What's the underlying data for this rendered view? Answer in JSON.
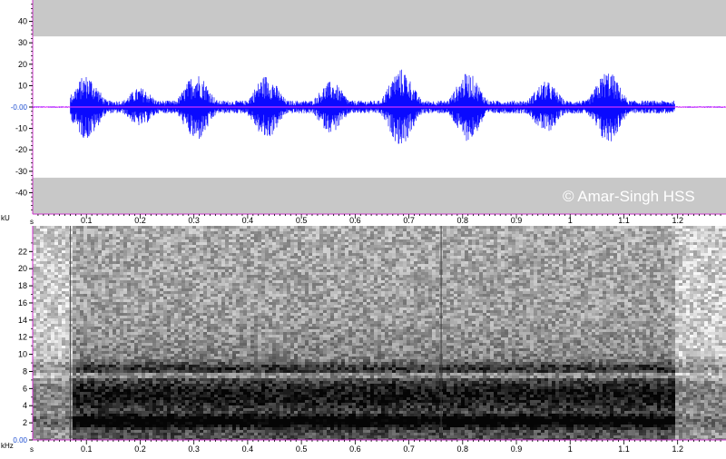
{
  "chart_data": [
    {
      "type": "line",
      "name": "waveform",
      "ylabel": "kU",
      "xlabel": "s",
      "xlim": [
        0,
        1.29
      ],
      "ylim": [
        -50,
        50
      ],
      "x_ticks": [
        0.1,
        0.2,
        0.3,
        0.4,
        0.5,
        0.6,
        0.7,
        0.8,
        0.9,
        1,
        1.1,
        1.2
      ],
      "x_tick_labels": [
        "0.1",
        "0.2",
        "0.3",
        "0.4",
        "0.5",
        "0.6",
        "0.7",
        "0.8",
        "0.9",
        "1",
        "1.1",
        "1.2"
      ],
      "y_ticks": [
        40,
        30,
        20,
        10,
        0,
        -10,
        -20,
        -30,
        -40
      ],
      "y_tick_labels": [
        "40",
        "30",
        "20",
        "10",
        "-0.00",
        "-10",
        "-20",
        "-30",
        "-40"
      ],
      "clip_band_abs": 33,
      "signal_start": 0.07,
      "signal_end": 1.195,
      "syllables": [
        {
          "t": 0.1,
          "amp": 15
        },
        {
          "t": 0.2,
          "amp": 9
        },
        {
          "t": 0.305,
          "amp": 16
        },
        {
          "t": 0.435,
          "amp": 15
        },
        {
          "t": 0.555,
          "amp": 12
        },
        {
          "t": 0.685,
          "amp": 18
        },
        {
          "t": 0.81,
          "amp": 16
        },
        {
          "t": 0.955,
          "amp": 12
        },
        {
          "t": 1.07,
          "amp": 17
        }
      ],
      "baseline_noise": 3
    },
    {
      "type": "heatmap",
      "name": "spectrogram",
      "ylabel": "kHz",
      "xlabel": "s",
      "xlim": [
        0,
        1.29
      ],
      "ylim": [
        0,
        25
      ],
      "x_ticks": [
        0.1,
        0.2,
        0.3,
        0.4,
        0.5,
        0.6,
        0.7,
        0.8,
        0.9,
        1,
        1.1,
        1.2
      ],
      "x_tick_labels": [
        "0.1",
        "0.2",
        "0.3",
        "0.4",
        "0.5",
        "0.6",
        "0.7",
        "0.8",
        "0.9",
        "1",
        "1.1",
        "1.2"
      ],
      "y_ticks": [
        22,
        20,
        18,
        16,
        14,
        12,
        10,
        8,
        6,
        4,
        2,
        0
      ],
      "y_tick_labels": [
        "22",
        "20",
        "18",
        "16",
        "14",
        "12",
        "10",
        "8",
        "6",
        "4",
        "2",
        "0.00"
      ],
      "signal_start": 0.07,
      "signal_end": 1.195,
      "dark_bands_khz": [
        {
          "center": 2.4,
          "width": 0.8,
          "strength": 0.95
        },
        {
          "center": 5.5,
          "width": 2.0,
          "strength": 0.7
        },
        {
          "center": 8.5,
          "width": 0.7,
          "strength": 0.6
        }
      ],
      "light_line_khz": 7.7,
      "vertical_artifacts_s": [
        0.07,
        0.76
      ]
    }
  ],
  "texts": {
    "watermark": "© Amar-Singh HSS",
    "wave_unit": "kU",
    "wave_axis_s": "s",
    "spec_unit": "kHz",
    "spec_axis_s": "s"
  },
  "colors": {
    "wave": "#0a0aff",
    "zero_line": "#ff3bff",
    "clip_band": "#c8c8c8",
    "axis_accent": "#cc33cc",
    "zero_label": "#1e4fd1"
  }
}
